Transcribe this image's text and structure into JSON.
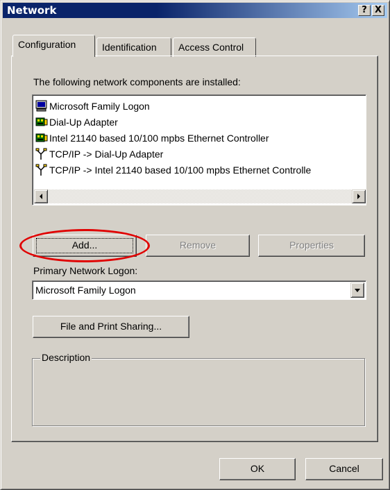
{
  "window": {
    "title": "Network",
    "help_glyph": "?",
    "close_glyph": "X"
  },
  "tabs": [
    {
      "label": "Configuration",
      "active": true
    },
    {
      "label": "Identification",
      "active": false
    },
    {
      "label": "Access Control",
      "active": false
    }
  ],
  "components_label": "The following network components are installed:",
  "components": [
    {
      "icon": "network-client-icon",
      "label": "Microsoft Family Logon"
    },
    {
      "icon": "network-adapter-icon",
      "label": "Dial-Up Adapter"
    },
    {
      "icon": "network-adapter-icon",
      "label": "Intel 21140 based 10/100 mpbs Ethernet Controller"
    },
    {
      "icon": "protocol-icon",
      "label": "TCP/IP -> Dial-Up Adapter"
    },
    {
      "icon": "protocol-icon",
      "label": "TCP/IP -> Intel 21140 based 10/100 mpbs Ethernet Controlle"
    }
  ],
  "buttons": {
    "add": "Add...",
    "remove": "Remove",
    "properties": "Properties",
    "file_print": "File and Print Sharing...",
    "ok": "OK",
    "cancel": "Cancel"
  },
  "primary_logon": {
    "label": "Primary Network Logon:",
    "value": "Microsoft Family Logon"
  },
  "description": {
    "label": "Description",
    "text": ""
  },
  "colors": {
    "title_bar": "#0a246a",
    "face": "#d4d0c8",
    "highlight_ellipse": "#e00000"
  }
}
